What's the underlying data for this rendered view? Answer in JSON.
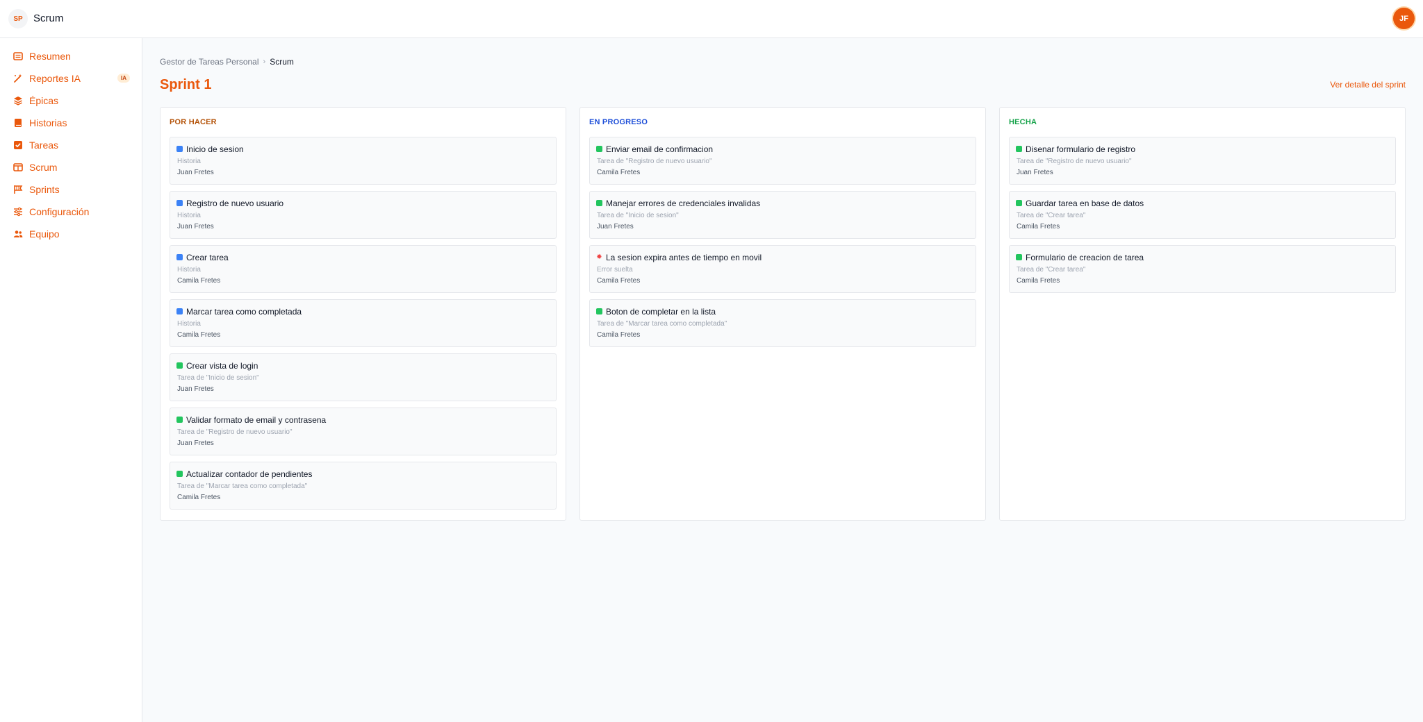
{
  "topbar": {
    "project_badge": "SP",
    "project_name": "Scrum",
    "user_initials": "JF"
  },
  "sidebar": {
    "items": [
      {
        "label": "Resumen",
        "icon": "list-icon"
      },
      {
        "label": "Reportes IA",
        "icon": "magic-wand-icon",
        "badge": "IA"
      },
      {
        "label": "Épicas",
        "icon": "layers-icon"
      },
      {
        "label": "Historias",
        "icon": "book-icon"
      },
      {
        "label": "Tareas",
        "icon": "checkbox-icon"
      },
      {
        "label": "Scrum",
        "icon": "board-icon"
      },
      {
        "label": "Sprints",
        "icon": "flag-icon"
      },
      {
        "label": "Configuración",
        "icon": "sliders-icon"
      },
      {
        "label": "Equipo",
        "icon": "users-icon"
      }
    ]
  },
  "breadcrumb": {
    "parent": "Gestor de Tareas Personal",
    "current": "Scrum"
  },
  "page": {
    "title": "Sprint 1",
    "detail_link": "Ver detalle del sprint"
  },
  "columns": [
    {
      "title": "POR HACER",
      "color": "#b45309",
      "cards": [
        {
          "type": "story",
          "title": "Inicio de sesion",
          "subtitle": "Historia",
          "assignee": "Juan Fretes"
        },
        {
          "type": "story",
          "title": "Registro de nuevo usuario",
          "subtitle": "Historia",
          "assignee": "Juan Fretes"
        },
        {
          "type": "story",
          "title": "Crear tarea",
          "subtitle": "Historia",
          "assignee": "Camila Fretes"
        },
        {
          "type": "story",
          "title": "Marcar tarea como completada",
          "subtitle": "Historia",
          "assignee": "Camila Fretes"
        },
        {
          "type": "task",
          "title": "Crear vista de login",
          "subtitle": "Tarea de \"Inicio de sesion\"",
          "assignee": "Juan Fretes"
        },
        {
          "type": "task",
          "title": "Validar formato de email y contrasena",
          "subtitle": "Tarea de \"Registro de nuevo usuario\"",
          "assignee": "Juan Fretes"
        },
        {
          "type": "task",
          "title": "Actualizar contador de pendientes",
          "subtitle": "Tarea de \"Marcar tarea como completada\"",
          "assignee": "Camila Fretes"
        }
      ]
    },
    {
      "title": "EN PROGRESO",
      "color": "#1d4ed8",
      "cards": [
        {
          "type": "task",
          "title": "Enviar email de confirmacion",
          "subtitle": "Tarea de \"Registro de nuevo usuario\"",
          "assignee": "Camila Fretes"
        },
        {
          "type": "task",
          "title": "Manejar errores de credenciales invalidas",
          "subtitle": "Tarea de \"Inicio de sesion\"",
          "assignee": "Juan Fretes"
        },
        {
          "type": "bug",
          "title": "La sesion expira antes de tiempo en movil",
          "subtitle": "Error suelta",
          "assignee": "Camila Fretes"
        },
        {
          "type": "task",
          "title": "Boton de completar en la lista",
          "subtitle": "Tarea de \"Marcar tarea como completada\"",
          "assignee": "Camila Fretes"
        }
      ]
    },
    {
      "title": "HECHA",
      "color": "#16a34a",
      "cards": [
        {
          "type": "task",
          "title": "Disenar formulario de registro",
          "subtitle": "Tarea de \"Registro de nuevo usuario\"",
          "assignee": "Juan Fretes"
        },
        {
          "type": "task",
          "title": "Guardar tarea en base de datos",
          "subtitle": "Tarea de \"Crear tarea\"",
          "assignee": "Camila Fretes"
        },
        {
          "type": "task",
          "title": "Formulario de creacion de tarea",
          "subtitle": "Tarea de \"Crear tarea\"",
          "assignee": "Camila Fretes"
        }
      ]
    }
  ]
}
